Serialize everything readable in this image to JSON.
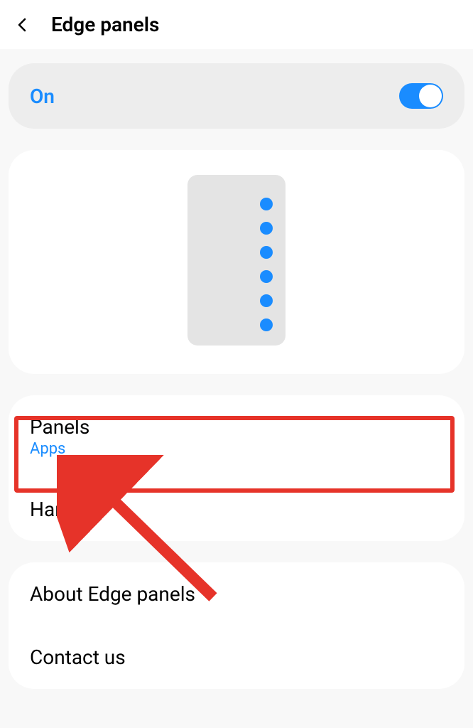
{
  "header": {
    "title": "Edge panels"
  },
  "toggle": {
    "label": "On",
    "state": "on"
  },
  "menu": {
    "panels": {
      "title": "Panels",
      "subtitle": "Apps"
    },
    "handle": {
      "title": "Handle"
    },
    "about": {
      "title": "About Edge panels"
    },
    "contact": {
      "title": "Contact us"
    }
  },
  "colors": {
    "accent": "#1a8cff",
    "highlight": "#e63329"
  }
}
